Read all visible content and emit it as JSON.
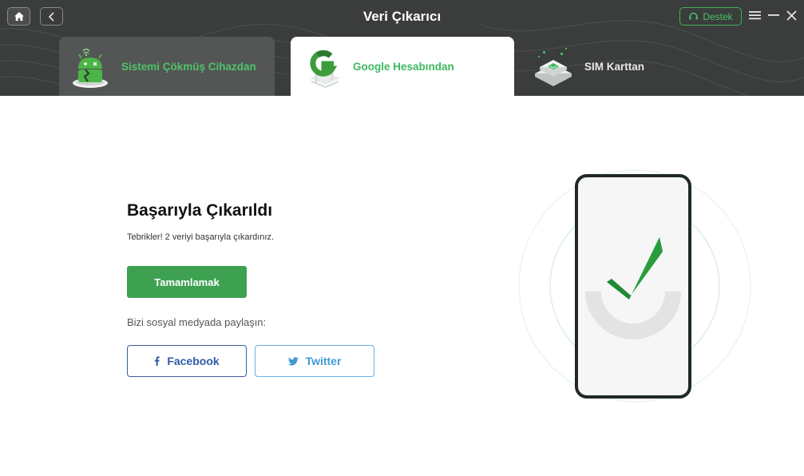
{
  "window": {
    "title": "Veri Çıkarıcı",
    "support_label": "Destek"
  },
  "tabs": [
    {
      "label": "Sistemi Çökmüş Cihazdan",
      "icon": "android-robot-icon",
      "active": false
    },
    {
      "label": "Google Hesabından",
      "icon": "google-account-icon",
      "active": true
    },
    {
      "label": "SIM Karttan",
      "icon": "sim-card-icon",
      "active": false
    }
  ],
  "result": {
    "title": "Başarıyla Çıkarıldı",
    "description": "Tebrikler! 2 veriyi başarıyla çıkardınız.",
    "done_label": "Tamamlamak",
    "share_label": "Bizi sosyal medyada paylaşın:",
    "facebook_label": "Facebook",
    "twitter_label": "Twitter"
  },
  "colors": {
    "accent_green": "#3ea152",
    "header_bg": "#3a3d3b",
    "facebook_blue": "#2e5aa8",
    "twitter_blue": "#4399d8"
  }
}
